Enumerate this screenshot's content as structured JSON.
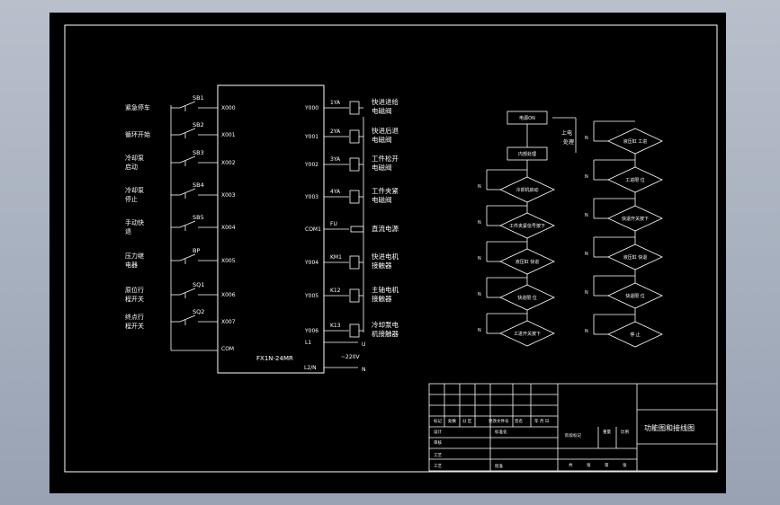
{
  "colors": {
    "background": "#000000",
    "line": "#ffffff",
    "frame_bg": "#a9b1bf"
  },
  "plc": {
    "model": "FX1N-24MR",
    "inputs": [
      {
        "switch": "SB1",
        "address": "X000",
        "label1": "紧急停车",
        "label2": ""
      },
      {
        "switch": "SB2",
        "address": "X001",
        "label1": "循环开始",
        "label2": ""
      },
      {
        "switch": "SB3",
        "address": "X002",
        "label1": "冷却泵",
        "label2": "启动"
      },
      {
        "switch": "SB4",
        "address": "X003",
        "label1": "冷却泵",
        "label2": "停止"
      },
      {
        "switch": "SB5",
        "address": "X004",
        "label1": "手动快",
        "label2": "退"
      },
      {
        "switch": "BP",
        "address": "X005",
        "label1": "压力继",
        "label2": "电器"
      },
      {
        "switch": "SQ1",
        "address": "X006",
        "label1": "原位行",
        "label2": "程开关"
      },
      {
        "switch": "SQ2",
        "address": "X007",
        "label1": "终点行",
        "label2": "程开关"
      }
    ],
    "com_in": "COM",
    "outputs": [
      {
        "address": "Y000",
        "device": "1YA",
        "label1": "快进进给",
        "label2": "电磁阀"
      },
      {
        "address": "Y001",
        "device": "2YA",
        "label1": "快进后退",
        "label2": "电磁阀"
      },
      {
        "address": "Y002",
        "device": "3YA",
        "label1": "工件松开",
        "label2": "电磁阀"
      },
      {
        "address": "Y003",
        "device": "4YA",
        "label1": "工件夹紧",
        "label2": "电磁阀"
      },
      {
        "address": "COM1",
        "device": "FU",
        "label1": "直流电源",
        "label2": ""
      },
      {
        "address": "Y004",
        "device": "KM1",
        "label1": "快进电机",
        "label2": "接触器"
      },
      {
        "address": "Y005",
        "device": "K12",
        "label1": "主轴电机",
        "label2": "接触器"
      },
      {
        "address": "Y006",
        "device": "K13",
        "label1": "冷却泵电",
        "label2": "机接触器"
      }
    ],
    "l1": "L1",
    "l2": "L2/N",
    "u_label": "U",
    "n_label": "N",
    "voltage": "~220V"
  },
  "flow_left": [
    {
      "kind": "rect",
      "text": "电源ON"
    },
    {
      "kind": "rect",
      "text": "内部处理"
    },
    {
      "kind": "diamond",
      "text": "冷却机启动"
    },
    {
      "kind": "diamond",
      "text": "工件夹紧信号按下"
    },
    {
      "kind": "diamond",
      "text": "液压缸 快进"
    },
    {
      "kind": "diamond",
      "text": "快进限 位"
    },
    {
      "kind": "diamond",
      "text": "工进开关按下"
    }
  ],
  "flow_right": [
    {
      "kind": "diamond",
      "text": "液压缸 工进"
    },
    {
      "kind": "diamond",
      "text": "工进限 位"
    },
    {
      "kind": "diamond",
      "text": "快退开关按下"
    },
    {
      "kind": "diamond",
      "text": "液压缸 快退"
    },
    {
      "kind": "diamond",
      "text": "快退限 位"
    },
    {
      "kind": "diamond",
      "text": "停 止"
    }
  ],
  "flow_labels": {
    "power_on": "上电",
    "processing": "处理",
    "n": "N"
  },
  "title_block": {
    "title": "功能图和接线图",
    "row1": [
      "标记",
      "处数",
      "分 区",
      "更改文件号",
      "签名",
      "年 月 日"
    ],
    "design": "设计",
    "std": "标准化",
    "check": "审核",
    "craft": "工艺",
    "approve": "批准",
    "process": "阶段标记",
    "weight": "重量",
    "scale": "比例",
    "sheet_parts": [
      "共",
      "张",
      "第",
      "张"
    ]
  }
}
